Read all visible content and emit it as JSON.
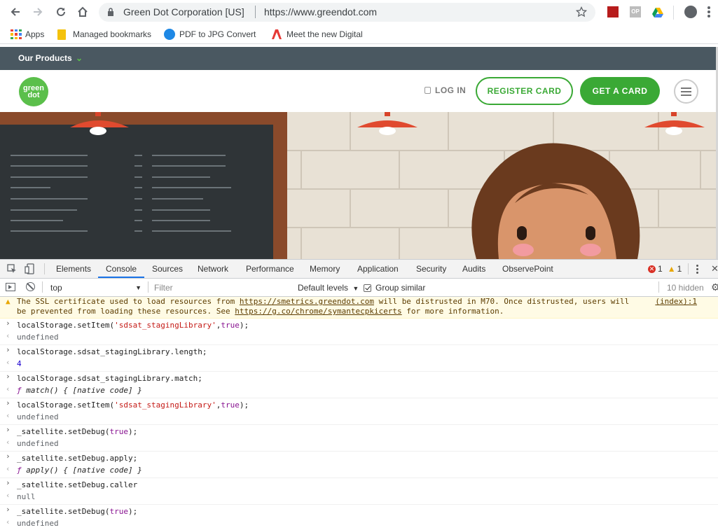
{
  "browser": {
    "site_name": "Green Dot Corporation [US]",
    "url": "https://www.greendot.com",
    "extensions": [
      "red-extension-icon",
      "op-extension-icon",
      "google-drive-icon"
    ]
  },
  "bookmarks": {
    "items": [
      {
        "label": "Apps",
        "icon": "apps-grid-icon"
      },
      {
        "label": "Managed bookmarks",
        "icon": "folder-icon"
      },
      {
        "label": "PDF to JPG Converte",
        "icon": "globe-icon"
      },
      {
        "label": "Meet the new Digital",
        "icon": "adobe-icon"
      }
    ]
  },
  "site": {
    "topbar_label": "Our Products",
    "logo_line1": "green",
    "logo_line2": "dot",
    "login_label": "LOG IN",
    "register_label": "REGISTER CARD",
    "get_card_label": "GET A CARD",
    "brand_color": "#3aa935"
  },
  "devtools": {
    "tabs": [
      "Elements",
      "Console",
      "Sources",
      "Network",
      "Performance",
      "Memory",
      "Application",
      "Security",
      "Audits",
      "ObservePoint"
    ],
    "active_tab": "Console",
    "error_count": "1",
    "warning_count": "1",
    "context": "top",
    "filter_placeholder": "Filter",
    "levels_label": "Default levels",
    "group_similar_label": "Group similar",
    "hidden_label": "10 hidden"
  },
  "console": {
    "warning": {
      "pre": "The SSL certificate used to load resources from ",
      "link1": "https://smetrics.greendot.com",
      "mid": " will be distrusted in M70. Once distrusted, users will be prevented from loading these resources. See ",
      "link2": "https://g.co/chrome/symantecpkicerts",
      "post": " for more information.",
      "source": "(index):1"
    },
    "entries": [
      {
        "in_a": "localStorage.setItem(",
        "in_str": "'sdsat_stagingLibrary'",
        "in_b": ",",
        "in_kw": "true",
        "in_c": ");",
        "out": "undefined"
      },
      {
        "in": "localStorage.sdsat_stagingLibrary.length;",
        "out_num": "4"
      },
      {
        "in": "localStorage.sdsat_stagingLibrary.match;",
        "out_f": "ƒ",
        "out_fn": " match() { [native code] }"
      },
      {
        "in_a": "localStorage.setItem(",
        "in_str": "'sdsat_stagingLibrary'",
        "in_b": ",",
        "in_kw": "true",
        "in_c": ");",
        "out": "undefined"
      },
      {
        "in_a": "_satellite.setDebug(",
        "in_kw": "true",
        "in_c": ");",
        "out": "undefined"
      },
      {
        "in": "_satellite.setDebug.apply;",
        "out_f": "ƒ",
        "out_fn": " apply() { [native code] }"
      },
      {
        "in": "_satellite.setDebug.caller",
        "out": "null"
      },
      {
        "in_a": "_satellite.setDebug(",
        "in_kw": "true",
        "in_c": ");",
        "out": "undefined"
      }
    ]
  }
}
